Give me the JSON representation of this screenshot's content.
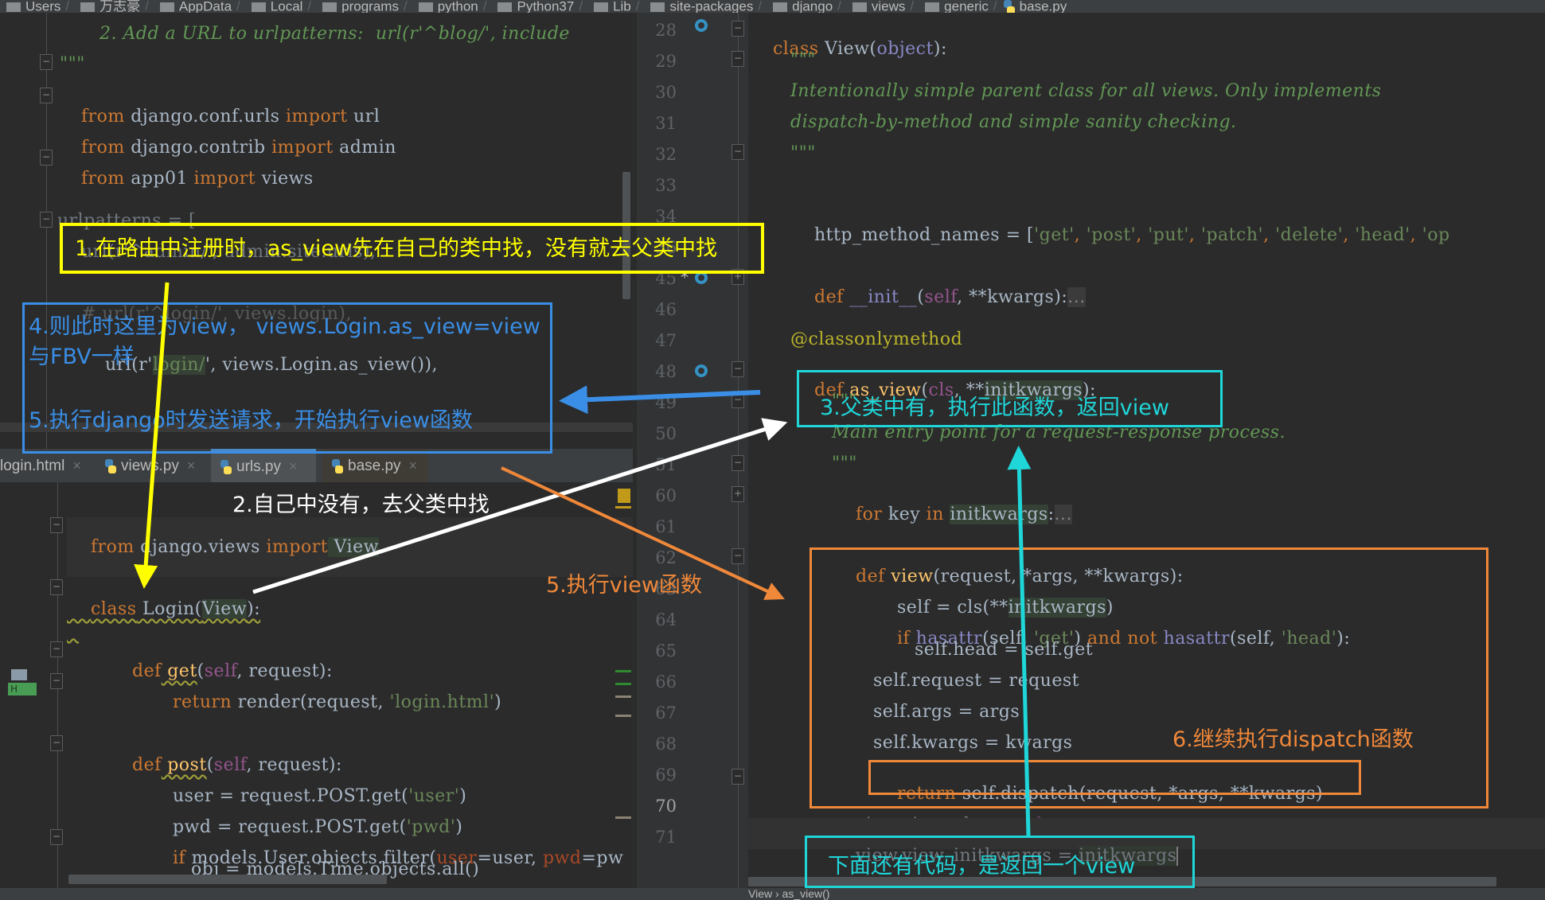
{
  "breadcrumb": [
    "Users",
    "万志豪",
    "AppData",
    "Local",
    "programs",
    "python",
    "Python37",
    "Lib",
    "site-packages",
    "django",
    "views",
    "generic",
    "base.py"
  ],
  "tabs": [
    {
      "label": "login.html",
      "icon": "html-file-icon",
      "active": false
    },
    {
      "label": "views.py",
      "icon": "python-file-icon",
      "active": false
    },
    {
      "label": "urls.py",
      "icon": "python-file-icon",
      "active": true
    },
    {
      "label": "base.py",
      "icon": "python-file-icon",
      "active": false
    }
  ],
  "urls_code": {
    "l1": "2. Add a URL to urlpatterns:  url(r'^blog/', include",
    "l2": "\"\"\"",
    "l3": [
      "from",
      " django.conf.urls ",
      "import",
      " url"
    ],
    "l4": [
      "from",
      " django.contrib ",
      "import",
      " admin"
    ],
    "l5": [
      "from",
      " app01 ",
      "import",
      " views"
    ],
    "l6": "urlpatterns = [",
    "l7": "    url(r'^admin/', admin.site.urls),",
    "l8": "    # url(r'^login/', views.login),",
    "l9": [
      "    url(r'",
      "login/",
      "', views.Login.as_view()),"
    ]
  },
  "views_code": {
    "l1": [
      "from",
      " django.views ",
      "import",
      " View"
    ],
    "l2": [
      "class",
      " Login(",
      "View",
      "):"
    ],
    "l3": [
      "def",
      " get",
      "(",
      "self",
      ", request):"
    ],
    "l4": [
      "return",
      " render(request, ",
      "'login.html'",
      ")"
    ],
    "l5": [
      "def",
      " post",
      "(",
      "self",
      ", request):"
    ],
    "l6": [
      "user = request.POST.get(",
      "'user'",
      ")"
    ],
    "l7": [
      "pwd = request.POST.get(",
      "'pwd'",
      ")"
    ],
    "l8": [
      "if",
      " models.User.objects.filter(",
      "user",
      "=user, ",
      "pwd",
      "=pw"
    ],
    "l9": "obj = models.Time.objects.all()"
  },
  "base_code": {
    "line_numbers": [
      "28",
      "29",
      "30",
      "31",
      "32",
      "33",
      "34",
      "36",
      "45",
      "46",
      "47",
      "48",
      "49",
      "50",
      "51",
      "60",
      "61",
      "62",
      "63",
      "64",
      "65",
      "66",
      "67",
      "68",
      "69",
      "70",
      "71"
    ],
    "class_line": [
      "class",
      " View(",
      "object",
      "):"
    ],
    "doc_open": "\"\"\"",
    "doc1": "Intentionally simple parent class for all views. Only implements",
    "doc2": "dispatch-by-method and simple sanity checking.",
    "doc_close": "\"\"\"",
    "http_methods": [
      "http_method_names = [",
      "'get'",
      ", ",
      "'post'",
      ", ",
      "'put'",
      ", ",
      "'patch'",
      ", ",
      "'delete'",
      ", ",
      "'head'",
      ", ",
      "'op"
    ],
    "init_line": [
      "def",
      " __init__",
      "(",
      "self",
      ", **kwargs):",
      "..."
    ],
    "decorator": "@classonlymethod",
    "as_view": [
      "def",
      " as_view",
      "(",
      "cls",
      ", **",
      "initkwargs",
      "):"
    ],
    "doc3_open": "\"\"\"",
    "doc3": "Main entry point for a request-response process.",
    "doc3_close": "\"\"\"",
    "for_line": [
      "for",
      " key ",
      "in",
      " ",
      "initkwargs",
      ":",
      "..."
    ],
    "view_def": [
      "def",
      " view",
      "(request, *args, **kwargs):"
    ],
    "self_cls": [
      "self = cls(**",
      "initkwargs",
      ")"
    ],
    "if_hasattr": [
      "if",
      " ",
      "hasattr",
      "(self, ",
      "'get'",
      ") ",
      "and not",
      " ",
      "hasattr",
      "(self, ",
      "'head'",
      "):"
    ],
    "self_head": "self.head = self.get",
    "self_request": "self.request = request",
    "self_args": "self.args = args",
    "self_kwargs": "self.kwargs = kwargs",
    "return_dispatch": [
      "return",
      " self.dispatch(request, *args, **kwargs)"
    ],
    "view_class": [
      "view.view_class = ",
      "cls"
    ],
    "view_initkwargs": [
      "view.view_initkwargs = ",
      "initkwargs"
    ]
  },
  "annotations": {
    "a1": "1.在路由中注册时，as_view先在自己的类中找，没有就去父类中找",
    "a2": "2.自己中没有，去父类中找",
    "a3": "3.父类中有，执行此函数，返回view",
    "a4_line1": "4.则此时这里为view，  views.Login.as_view=view",
    "a4_line2": "与FBV一样",
    "a5_blue": "5.执行django时发送请求，开始执行view函数",
    "a5_orange": "5.执行view函数",
    "a6": "6.继续执行dispatch函数",
    "a7": "下面还有代码，是返回一个view"
  },
  "status": {
    "breadcrumb_text": "View  ›  as_view()"
  },
  "colors": {
    "yellow": "#ffff00",
    "blue": "#3a8ee6",
    "cyan": "#1fd6d9",
    "orange": "#f0883a",
    "white": "#ffffff"
  }
}
